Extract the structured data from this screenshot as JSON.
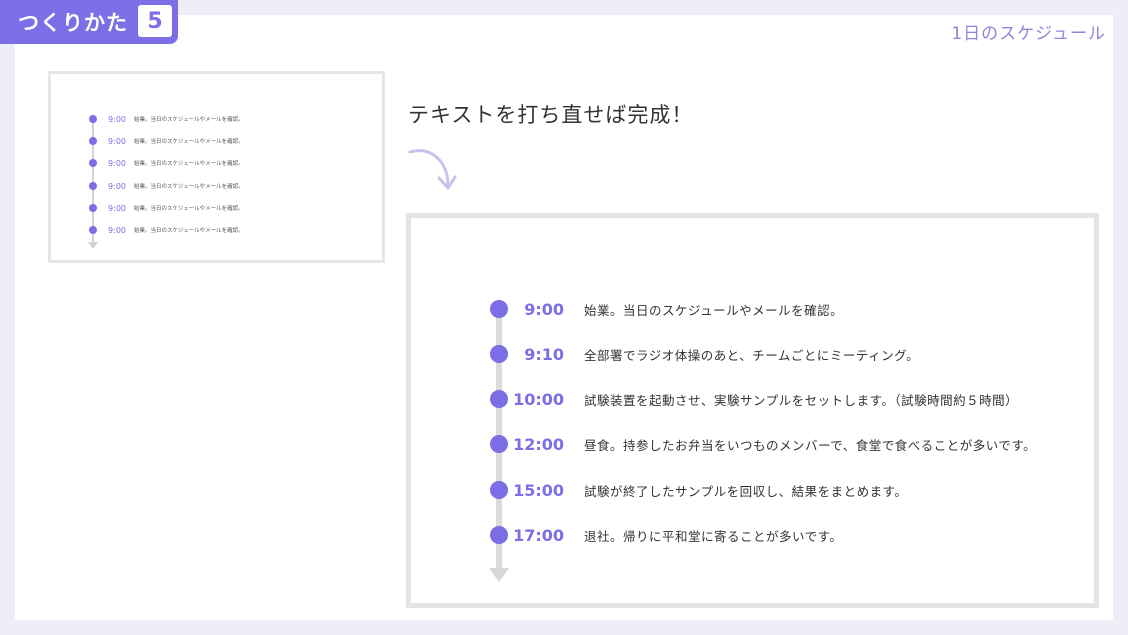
{
  "badge": {
    "label": "つくりかた",
    "step": "5"
  },
  "section_title": "1日のスケジュール",
  "headline": "テキストを打ち直せば完成！",
  "thumbnail": {
    "items": [
      {
        "time": "9:00",
        "text": "始業。当日のスケジュールやメールを確認。"
      },
      {
        "time": "9:00",
        "text": "始業。当日のスケジュールやメールを確認。"
      },
      {
        "time": "9:00",
        "text": "始業。当日のスケジュールやメールを確認。"
      },
      {
        "time": "9:00",
        "text": "始業。当日のスケジュールやメールを確認。"
      },
      {
        "time": "9:00",
        "text": "始業。当日のスケジュールやメールを確認。"
      },
      {
        "time": "9:00",
        "text": "始業。当日のスケジュールやメールを確認。"
      }
    ]
  },
  "schedule": {
    "items": [
      {
        "time": "9:00",
        "text": "始業。当日のスケジュールやメールを確認。"
      },
      {
        "time": "9:10",
        "text": "全部署でラジオ体操のあと、チームごとにミーティング。"
      },
      {
        "time": "10:00",
        "text": "試験装置を起動させ、実験サンプルをセットします。（試験時間約５時間）"
      },
      {
        "time": "12:00",
        "text": "昼食。持参したお弁当をいつものメンバーで、食堂で食べることが多いです。"
      },
      {
        "time": "15:00",
        "text": "試験が終了したサンプルを回収し、結果をまとめます。"
      },
      {
        "time": "17:00",
        "text": "退社。帰りに平和堂に寄ることが多いです。"
      }
    ]
  },
  "colors": {
    "accent": "#7b6ee6",
    "background": "#efeef8",
    "line": "#dcdcdc"
  },
  "icons": {
    "arrow": "curved-arrow-icon"
  }
}
